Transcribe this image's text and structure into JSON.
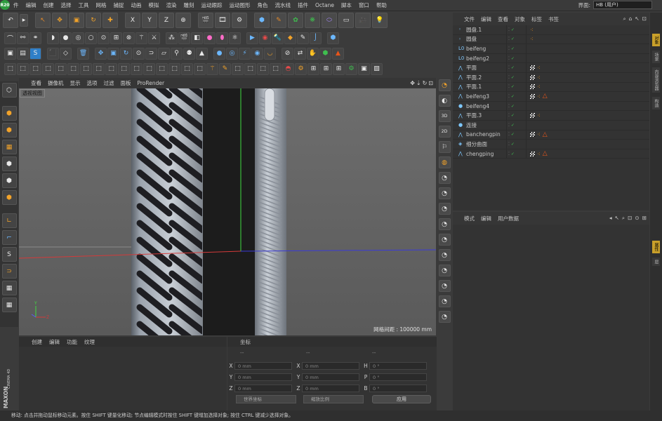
{
  "menu": [
    "件",
    "编辑",
    "创建",
    "选择",
    "工具",
    "网格",
    "捕捉",
    "动画",
    "模拟",
    "渲染",
    "雕刻",
    "运动跟踪",
    "运动图形",
    "角色",
    "流水线",
    "插件",
    "Octane",
    "脚本",
    "窗口",
    "帮助"
  ],
  "logo": "R20",
  "layout": {
    "label": "界面:",
    "value": "HB (用户)"
  },
  "viewport": {
    "menu": [
      "查看",
      "摄像机",
      "显示",
      "选项",
      "过滤",
      "面板",
      "ProRender"
    ],
    "label": "透视视图",
    "grid": "网格间距 : 100000 mm",
    "nav": [
      "✥",
      "⇣",
      "↻",
      "⊡"
    ]
  },
  "bottom_left": {
    "menu": [
      "创建",
      "编辑",
      "功能",
      "纹理"
    ]
  },
  "coords": {
    "title": "坐标",
    "cols": [
      "--",
      "--",
      "--"
    ],
    "rows": [
      {
        "a": "X",
        "av": "0 mm",
        "b": "X",
        "bv": "0 mm",
        "c": "H",
        "cv": "0 °"
      },
      {
        "a": "Y",
        "av": "0 mm",
        "b": "Y",
        "bv": "0 mm",
        "c": "P",
        "cv": "0 °"
      },
      {
        "a": "Z",
        "av": "0 mm",
        "b": "Z",
        "bv": "0 mm",
        "c": "B",
        "cv": "0 °"
      }
    ],
    "dropdown1": "世界坐标",
    "dropdown2": "缩放比例",
    "apply": "应用"
  },
  "objects": {
    "menu": [
      "文件",
      "编辑",
      "查看",
      "对象",
      "标签",
      "书签"
    ],
    "tools": [
      "⌕",
      "⌂",
      "↖",
      "⊡"
    ],
    "rows": [
      {
        "name": "圆盘.1",
        "icon": "◦",
        "tags": "dot"
      },
      {
        "name": "圆盘",
        "icon": "◦",
        "tags": "dot"
      },
      {
        "name": "beifeng",
        "icon": "L0",
        "tags": ""
      },
      {
        "name": "beifeng2",
        "icon": "L0",
        "tags": ""
      },
      {
        "name": "平面",
        "icon": "⋀",
        "tags": "chk"
      },
      {
        "name": "平面.2",
        "icon": "⋀",
        "tags": "chk"
      },
      {
        "name": "平面.1",
        "icon": "⋀",
        "tags": "chk"
      },
      {
        "name": "beifeng3",
        "icon": "⋀",
        "tags": "chktri"
      },
      {
        "name": "beifeng4",
        "icon": "●",
        "tags": ""
      },
      {
        "name": "平面.3",
        "icon": "⋀",
        "tags": "chk"
      },
      {
        "name": "连接",
        "icon": "●",
        "tags": ""
      },
      {
        "name": "banchengpin",
        "icon": "⋀",
        "tags": "chktri"
      },
      {
        "name": "细分曲面",
        "icon": "◈",
        "tags": ""
      },
      {
        "name": "chengping",
        "icon": "⋀",
        "tags": "chktri"
      }
    ]
  },
  "attributes": {
    "menu": [
      "模式",
      "编辑",
      "用户数据"
    ],
    "tools": [
      "◂",
      "↖",
      "⌕",
      "⊡",
      "⊙",
      "⊞"
    ]
  },
  "far_right_tabs": [
    "对象",
    "场景",
    "内容浏览器",
    "构造"
  ],
  "far_right_tabs2": [
    "属性",
    "层"
  ],
  "brand": "MAXON CINEMA 4D",
  "status": "移动: 点击并拖动鼠标移动元素。按住 SHIFT 键量化移动; 节点编辑模式时按住 SHIFT 键增加选择对象; 按住 CTRL 键减少选择对象。"
}
